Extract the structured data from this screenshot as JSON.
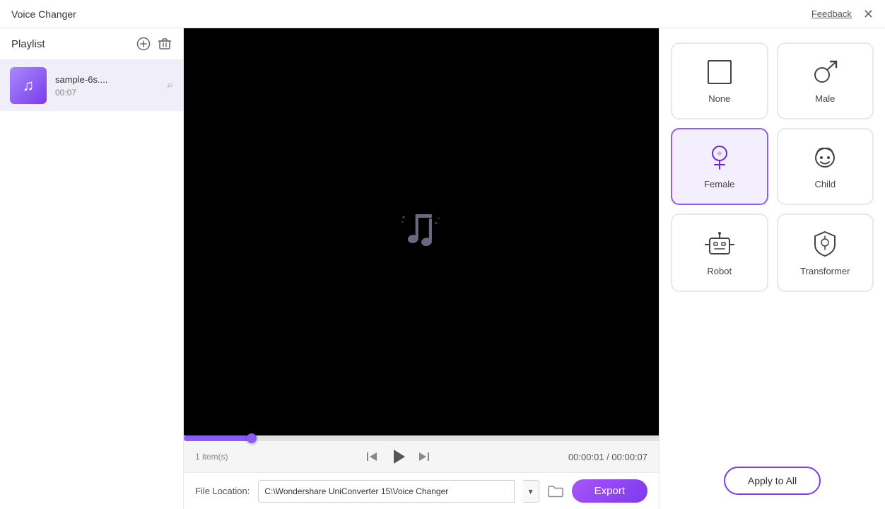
{
  "titleBar": {
    "title": "Voice Changer",
    "feedback": "Feedback",
    "close": "✕"
  },
  "sidebar": {
    "title": "Playlist",
    "addIcon": "⊕",
    "deleteIcon": "🗑",
    "item": {
      "name": "sample-6s....",
      "duration": "00:07"
    },
    "itemCount": "1 item(s)"
  },
  "player": {
    "progress": 14.28,
    "time": "00:00:01 / 00:00:07"
  },
  "fileLocation": {
    "label": "File Location:",
    "path": "C:\\Wondershare UniConverter 15\\Voice Changer",
    "placeholder": "C:\\Wondershare UniConverter 15\\Voice Changer"
  },
  "exportButton": "Export",
  "voiceOptions": [
    {
      "id": "none",
      "label": "None",
      "icon": "none",
      "active": false
    },
    {
      "id": "male",
      "label": "Male",
      "icon": "male",
      "active": false
    },
    {
      "id": "female",
      "label": "Female",
      "icon": "female",
      "active": true
    },
    {
      "id": "child",
      "label": "Child",
      "icon": "child",
      "active": false
    },
    {
      "id": "robot",
      "label": "Robot",
      "icon": "robot",
      "active": false
    },
    {
      "id": "transformer",
      "label": "Transformer",
      "icon": "transformer",
      "active": false
    }
  ],
  "applyAllButton": "Apply to All"
}
